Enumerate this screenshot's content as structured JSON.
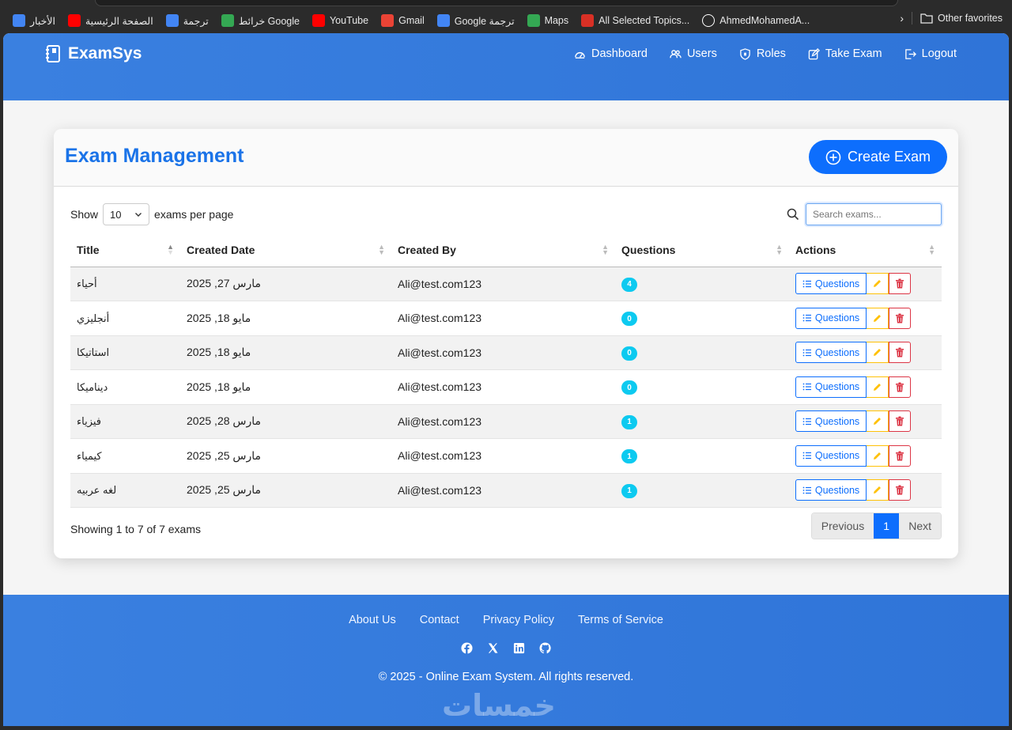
{
  "bookmarks": {
    "items": [
      {
        "label": "الأخبار",
        "icon": "google-news-icon",
        "color": "#4285f4"
      },
      {
        "label": "الصفحة الرئيسية",
        "icon": "youtube-icon",
        "color": "#ff0000"
      },
      {
        "label": "ترجمة",
        "icon": "google-translate-icon",
        "color": "#4285f4"
      },
      {
        "label": "خرائط Google",
        "icon": "google-maps-icon",
        "color": "#34a853"
      },
      {
        "label": "YouTube",
        "icon": "youtube-icon",
        "color": "#ff0000"
      },
      {
        "label": "Gmail",
        "icon": "gmail-icon",
        "color": "#ea4335"
      },
      {
        "label": "Google ترجمة",
        "icon": "google-translate-icon",
        "color": "#4285f4"
      },
      {
        "label": "Maps",
        "icon": "google-maps-icon",
        "color": "#34a853"
      },
      {
        "label": "All Selected Topics...",
        "icon": "pdf-icon",
        "color": "#d93025"
      },
      {
        "label": "AhmedMohamedA...",
        "icon": "github-icon",
        "color": "#ffffff"
      }
    ],
    "other_favorites": "Other favorites"
  },
  "nav": {
    "brand": "ExamSys",
    "links": [
      {
        "label": "Dashboard",
        "icon": "dashboard-icon"
      },
      {
        "label": "Users",
        "icon": "users-icon"
      },
      {
        "label": "Roles",
        "icon": "shield-icon"
      },
      {
        "label": "Take Exam",
        "icon": "edit-icon"
      },
      {
        "label": "Logout",
        "icon": "logout-icon"
      }
    ]
  },
  "card": {
    "title": "Exam Management",
    "create_label": "Create Exam"
  },
  "controls": {
    "show": "Show",
    "per_page": "10",
    "per_page_suffix": "exams per page",
    "search_placeholder": "Search exams..."
  },
  "table": {
    "columns": [
      "Title",
      "Created Date",
      "Created By",
      "Questions",
      "Actions"
    ],
    "questions_btn": "Questions",
    "rows": [
      {
        "title": "أحياء",
        "date": "مارس 27, 2025",
        "by": "Ali@test.com123",
        "questions": "4"
      },
      {
        "title": "أنجليزي",
        "date": "مايو 18, 2025",
        "by": "Ali@test.com123",
        "questions": "0"
      },
      {
        "title": "استاتيكا",
        "date": "مايو 18, 2025",
        "by": "Ali@test.com123",
        "questions": "0"
      },
      {
        "title": "ديناميكا",
        "date": "مايو 18, 2025",
        "by": "Ali@test.com123",
        "questions": "0"
      },
      {
        "title": "فيزياء",
        "date": "مارس 28, 2025",
        "by": "Ali@test.com123",
        "questions": "1"
      },
      {
        "title": "كيمياء",
        "date": "مارس 25, 2025",
        "by": "Ali@test.com123",
        "questions": "1"
      },
      {
        "title": "لغه عربيه",
        "date": "مارس 25, 2025",
        "by": "Ali@test.com123",
        "questions": "1"
      }
    ]
  },
  "pagination": {
    "info": "Showing 1 to 7 of 7 exams",
    "previous": "Previous",
    "current": "1",
    "next": "Next"
  },
  "footer": {
    "links": [
      "About Us",
      "Contact",
      "Privacy Policy",
      "Terms of Service"
    ],
    "copyright": "© 2025 - Online Exam System. All rights reserved.",
    "watermark": "خمسات"
  }
}
